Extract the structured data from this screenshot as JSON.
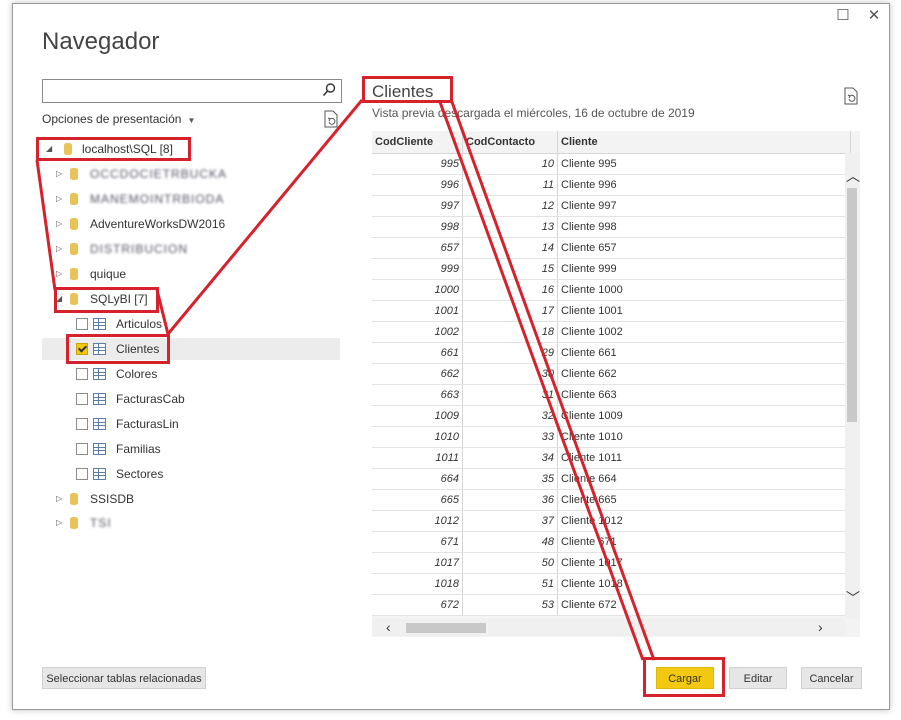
{
  "window": {
    "maximize_glyph": "☐",
    "close_glyph": "✕"
  },
  "title": "Navegador",
  "search": {
    "value": "",
    "placeholder": ""
  },
  "display_options": "Opciones de presentación",
  "tree": {
    "root": "localhost\\SQL [8]",
    "databases": [
      "OCCDOCIETRBUCKA",
      "MANEMOINTRBIODA",
      "AdventureWorksDW2016",
      "DISTRIBUCION",
      "quique"
    ],
    "sqlybi": {
      "label": "SQLyBI [7]",
      "tables": [
        "Articulos",
        "Clientes",
        "Colores",
        "FacturasCab",
        "FacturasLin",
        "Familias",
        "Sectores"
      ],
      "checked": "Clientes"
    },
    "after": [
      "SSISDB",
      "TSI"
    ]
  },
  "preview": {
    "title": "Clientes",
    "subtitle": "Vista previa descargada el miércoles, 16 de octubre de 2019",
    "columns": [
      "CodCliente",
      "CodContacto",
      "Cliente"
    ],
    "rows": [
      [
        "995",
        "10",
        "Cliente 995"
      ],
      [
        "996",
        "11",
        "Cliente 996"
      ],
      [
        "997",
        "12",
        "Cliente 997"
      ],
      [
        "998",
        "13",
        "Cliente 998"
      ],
      [
        "657",
        "14",
        "Cliente 657"
      ],
      [
        "999",
        "15",
        "Cliente 999"
      ],
      [
        "1000",
        "16",
        "Cliente 1000"
      ],
      [
        "1001",
        "17",
        "Cliente 1001"
      ],
      [
        "1002",
        "18",
        "Cliente 1002"
      ],
      [
        "661",
        "29",
        "Cliente 661"
      ],
      [
        "662",
        "30",
        "Cliente 662"
      ],
      [
        "663",
        "31",
        "Cliente 663"
      ],
      [
        "1009",
        "32",
        "Cliente 1009"
      ],
      [
        "1010",
        "33",
        "Cliente 1010"
      ],
      [
        "1011",
        "34",
        "Cliente 1011"
      ],
      [
        "664",
        "35",
        "Cliente 664"
      ],
      [
        "665",
        "36",
        "Cliente 665"
      ],
      [
        "1012",
        "37",
        "Cliente 1012"
      ],
      [
        "671",
        "48",
        "Cliente 671"
      ],
      [
        "1017",
        "50",
        "Cliente 1017"
      ],
      [
        "1018",
        "51",
        "Cliente 1018"
      ],
      [
        "672",
        "53",
        "Cliente 672"
      ]
    ]
  },
  "buttons": {
    "related": "Seleccionar tablas relacionadas",
    "load": "Cargar",
    "edit": "Editar",
    "cancel": "Cancelar"
  },
  "colors": {
    "accent": "#f2c811",
    "annotation": "#d5222b"
  }
}
